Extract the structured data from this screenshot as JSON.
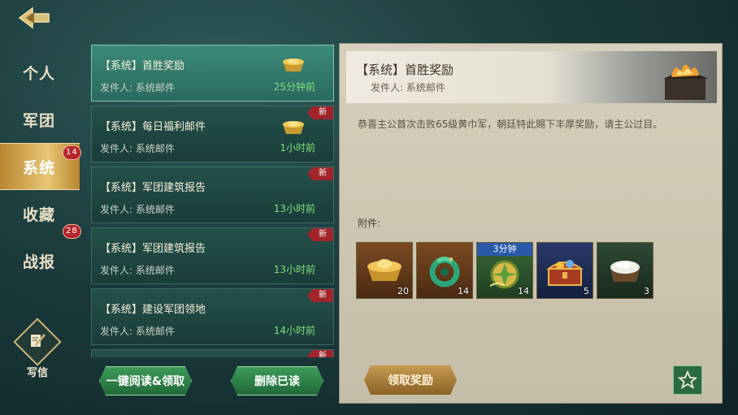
{
  "nav": [
    {
      "label": "个人",
      "badge": ""
    },
    {
      "label": "军团",
      "badge": ""
    },
    {
      "label": "系统",
      "badge": "14"
    },
    {
      "label": "收藏",
      "badge": ""
    },
    {
      "label": "战报",
      "badge": "28"
    }
  ],
  "write_label": "写信",
  "mails": [
    {
      "title": "【系统】首胜奖励",
      "sender": "发件人: 系统邮件",
      "time": "25分钟前",
      "new": ""
    },
    {
      "title": "【系统】每日福利邮件",
      "sender": "发件人: 系统邮件",
      "time": "1小时前",
      "new": "新"
    },
    {
      "title": "【系统】军团建筑报告",
      "sender": "发件人: 系统邮件",
      "time": "13小时前",
      "new": "新"
    },
    {
      "title": "【系统】军团建筑报告",
      "sender": "发件人: 系统邮件",
      "time": "13小时前",
      "new": "新"
    },
    {
      "title": "【系统】建设军团领地",
      "sender": "发件人: 系统邮件",
      "time": "14小时前",
      "new": "新"
    },
    {
      "title": "",
      "sender": "",
      "time": "",
      "new": "新"
    }
  ],
  "buttons": {
    "read_all": "一键阅读&领取",
    "delete_read": "删除已读",
    "claim": "领取奖励"
  },
  "detail": {
    "title": "【系统】首胜奖励",
    "sender": "发件人: 系统邮件",
    "body": "恭喜主公首次击败65级黄巾军，朝廷特此赐下丰厚奖励，请主公过目。",
    "attach_label": "附件:",
    "items": [
      {
        "icon": "gold-ingot-icon",
        "count": "20",
        "timer": ""
      },
      {
        "icon": "jade-dragon-icon",
        "count": "14",
        "timer": ""
      },
      {
        "icon": "speedup-token-icon",
        "count": "14",
        "timer": "3分钟"
      },
      {
        "icon": "treasure-chest-icon",
        "count": "5",
        "timer": ""
      },
      {
        "icon": "rice-cart-icon",
        "count": "3",
        "timer": ""
      }
    ]
  },
  "colors": {
    "accent_gold": "#e8c676",
    "time_green": "#7ee07a",
    "badge_red": "#b5262b"
  }
}
